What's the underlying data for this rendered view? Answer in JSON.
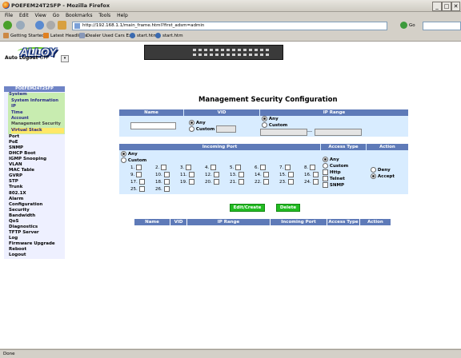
{
  "window": {
    "title": "POEFEM24T2SFP - Mozilla Firefox"
  },
  "menubar": [
    "File",
    "Edit",
    "View",
    "Go",
    "Bookmarks",
    "Tools",
    "Help"
  ],
  "navbar": {
    "url": "http://192.168.1.1/main_frame.html?first_adsm=admin",
    "go_label": "Go"
  },
  "bookmarks": [
    "Getting Started",
    "Latest Headlines",
    "Dealer Used Cars Ex...",
    "start.htm",
    "start.htm"
  ],
  "header": {
    "logo_text": "ALLOY",
    "auto_logout_label": "Auto Logout",
    "auto_logout_value": "OFF"
  },
  "sidebar": {
    "device": "POEFEM24T2SFP",
    "system_label": "System",
    "system_subitems": [
      "System Information",
      "IP",
      "Time",
      "Account",
      "Management Security",
      "Virtual Stack"
    ],
    "items": [
      "Port",
      "PoE",
      "SNMP",
      "DHCP Boot",
      "IGMP Snooping",
      "VLAN",
      "MAC Table",
      "GVRP",
      "STP",
      "Trunk",
      "802.1X",
      "Alarm",
      "Configuration",
      "Security",
      "Bandwidth",
      "QoS",
      "Diagnostics",
      "TFTP Server",
      "Log",
      "Firmware Upgrade",
      "Reboot",
      "Logout"
    ]
  },
  "main": {
    "title": "Management Security Configuration",
    "top_headers": [
      "Name",
      "VID",
      "IP Range"
    ],
    "vid_options": [
      "Any",
      "Custom"
    ],
    "ip_options": [
      "Any",
      "Custom"
    ],
    "ip_separator": "---",
    "port_headers": [
      "Incoming Port",
      "Access Type",
      "Action"
    ],
    "port_options": [
      "Any",
      "Custom"
    ],
    "ports": [
      "1.",
      "2.",
      "3.",
      "4.",
      "5.",
      "6.",
      "7.",
      "8.",
      "9.",
      "10.",
      "11.",
      "12.",
      "13.",
      "14.",
      "15.",
      "16.",
      "17.",
      "18.",
      "19.",
      "20.",
      "21.",
      "22.",
      "23.",
      "24.",
      "25.",
      "26."
    ],
    "access_options": [
      "Any",
      "Custom",
      "Http",
      "Telnet",
      "SNMP"
    ],
    "action_options": [
      "Deny",
      "Accept"
    ],
    "buttons": {
      "add": "Edit/Create",
      "delete": "Delete"
    },
    "list_headers": [
      "Name",
      "VID",
      "IP Range",
      "Incoming Port",
      "Access Type",
      "Action"
    ]
  },
  "status": {
    "text": "Done"
  },
  "colors": {
    "header_blue": "#5e7ab8",
    "panel_blue": "#d8ecff",
    "button_green": "#22bb22",
    "submenu_green": "#c8ecb0",
    "selected_yellow": "#ffe868"
  }
}
